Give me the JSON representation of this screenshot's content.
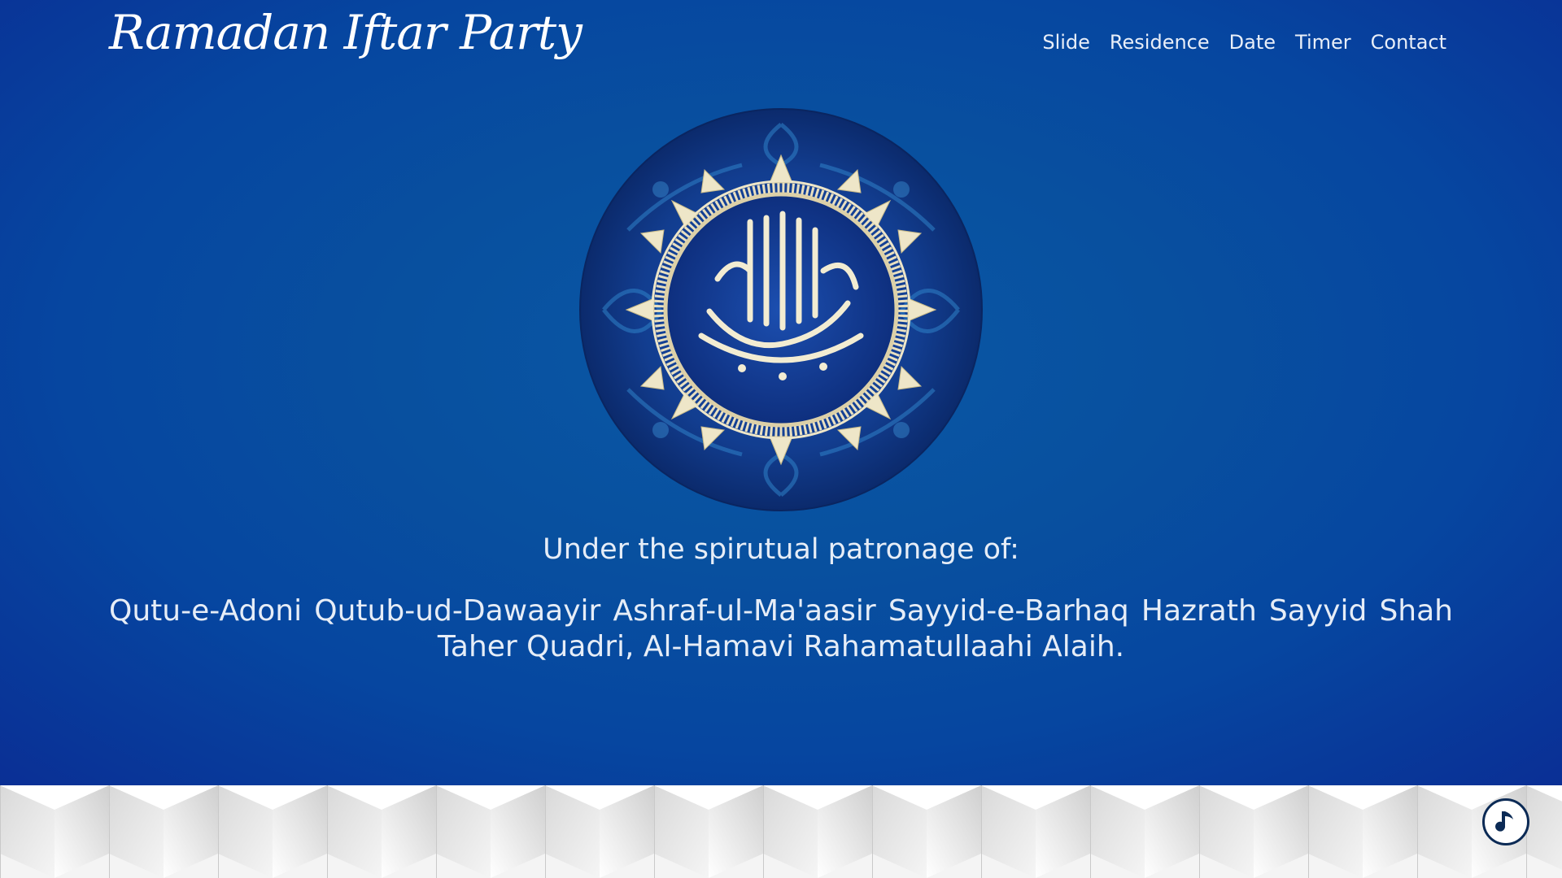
{
  "brand": {
    "title": "Ramadan Iftar Party"
  },
  "nav": {
    "items": [
      {
        "label": "Slide"
      },
      {
        "label": "Residence"
      },
      {
        "label": "Date"
      },
      {
        "label": "Timer"
      },
      {
        "label": "Contact"
      }
    ]
  },
  "hero": {
    "emblem_icon": "bismillah-calligraphy-medallion",
    "patronage_label": "Under the spirutual patronage of:",
    "patronage_names": "Qutu-e-Adoni Qutub-ud-Dawaayir Ashraf-ul-Ma'aasir Sayyid-e-Barhaq Hazrath Sayyid Shah Taher Quadri, Al-Hamavi Rahamatullaahi Alaih."
  },
  "footer": {
    "music_icon": "music-note-icon"
  },
  "colors": {
    "hero_blue": "#0a4fa0",
    "gold": "#e9dcb0",
    "text": "#e6edf7"
  }
}
